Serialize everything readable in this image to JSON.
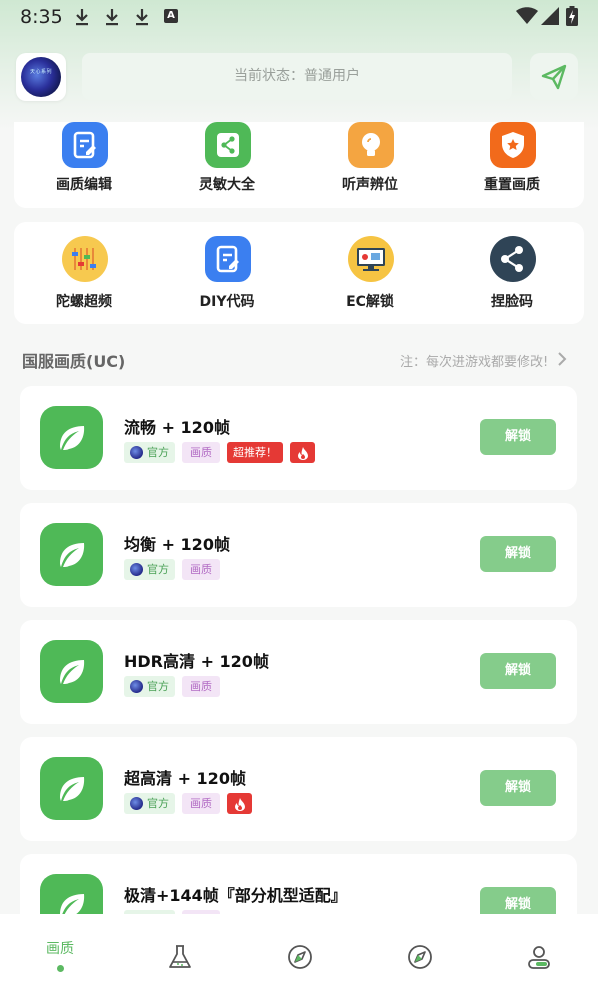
{
  "status_bar": {
    "time": "8:35",
    "icons": [
      "download-icon",
      "download-icon",
      "download-icon",
      "a-app-icon",
      "wifi-icon",
      "signal-icon",
      "battery-icon"
    ]
  },
  "header": {
    "avatar_text": "天心系列",
    "status_text": "当前状态：普通用户",
    "send_icon": "send-icon"
  },
  "tools_row1": [
    {
      "label": "画质编辑",
      "icon": "image-edit-icon",
      "color": "#3b7ff0"
    },
    {
      "label": "灵敏大全",
      "icon": "share-icon",
      "color": "#4fb957"
    },
    {
      "label": "听声辨位",
      "icon": "lightbulb-icon",
      "color": "#f4a541"
    },
    {
      "label": "重置画质",
      "icon": "shield-star-icon",
      "color": "#f26a1b"
    }
  ],
  "tools_row2": [
    {
      "label": "陀螺超频",
      "icon": "sliders-icon",
      "color": "#f7c94f"
    },
    {
      "label": "DIY代码",
      "icon": "code-edit-icon",
      "color": "#3b7ff0"
    },
    {
      "label": "EC解锁",
      "icon": "monitor-icon",
      "color": "#f6c443"
    },
    {
      "label": "捏脸码",
      "icon": "share-nodes-icon",
      "color": "#2f4456"
    }
  ],
  "section": {
    "title": "国服画质(UC)",
    "note": "注：每次进游戏都要修改!"
  },
  "items": [
    {
      "title": "流畅 + 120帧",
      "tag_official": "官方",
      "tag_quality": "画质",
      "tag_hot": "超推荐！",
      "fire": true,
      "unlock": "解锁"
    },
    {
      "title": "均衡 + 120帧",
      "tag_official": "官方",
      "tag_quality": "画质",
      "tag_hot": "",
      "fire": false,
      "unlock": "解锁"
    },
    {
      "title": "HDR高清 + 120帧",
      "tag_official": "官方",
      "tag_quality": "画质",
      "tag_hot": "",
      "fire": false,
      "unlock": "解锁"
    },
    {
      "title": "超高清 + 120帧",
      "tag_official": "官方",
      "tag_quality": "画质",
      "tag_hot": "",
      "fire": true,
      "unlock": "解锁"
    },
    {
      "title": "极清+144帧『部分机型适配』",
      "tag_official": "官方",
      "tag_quality": "画质",
      "tag_hot": "",
      "fire": false,
      "unlock": "解锁"
    }
  ],
  "bottom_nav": [
    {
      "label": "画质",
      "icon": "",
      "active": true
    },
    {
      "label": "",
      "icon": "flask-icon",
      "active": false
    },
    {
      "label": "",
      "icon": "compass-icon",
      "active": false
    },
    {
      "label": "",
      "icon": "compass-icon",
      "active": false
    },
    {
      "label": "",
      "icon": "user-icon",
      "active": false
    }
  ]
}
